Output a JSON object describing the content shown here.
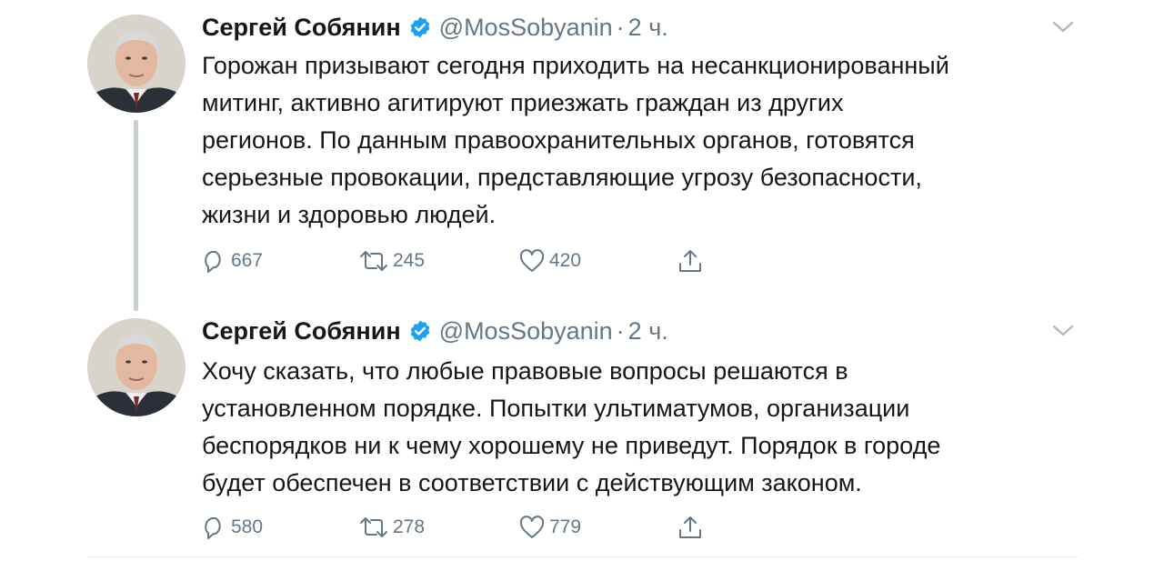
{
  "tweets": [
    {
      "author_name": "Сергей Собянин",
      "handle": "@MosSobyanin",
      "separator": "·",
      "time": "2 ч.",
      "text_lines": [
        "Горожан призывают сегодня приходить на несанкционированный",
        "митинг, активно агитируют приезжать граждан из других",
        "регионов. По данным правоохранительных органов, готовятся",
        "серьезные провокации, представляющие угрозу безопасности,",
        "жизни и здоровью людей."
      ],
      "replies": "667",
      "retweets": "245",
      "likes": "420"
    },
    {
      "author_name": "Сергей Собянин",
      "handle": "@MosSobyanin",
      "separator": "·",
      "time": "2 ч.",
      "text_lines": [
        "Хочу сказать, что любые правовые вопросы решаются в",
        "установленном порядке. Попытки ультиматумов, организации",
        "беспорядков ни к чему хорошему не приведут. Порядок в городе",
        "будет обеспечен в соответствии с действующим законом."
      ],
      "replies": "580",
      "retweets": "278",
      "likes": "779"
    }
  ],
  "colors": {
    "text": "#14171a",
    "secondary": "#657786",
    "verified": "#1da1f2",
    "thread_line": "#c4cfd6"
  },
  "icons": [
    "verified-badge-icon",
    "chevron-down-icon",
    "reply-icon",
    "retweet-icon",
    "like-icon",
    "share-icon"
  ]
}
